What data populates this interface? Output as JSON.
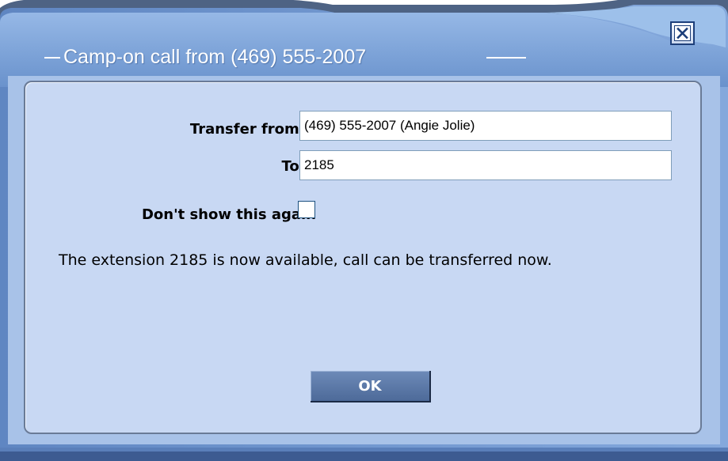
{
  "window": {
    "title": "Camp-on call from (469) 555-2007"
  },
  "form": {
    "transfer_from_label": "Transfer from:",
    "transfer_from_value": "(469) 555-2007 (Angie Jolie)",
    "to_label": "To:",
    "to_value": "2185",
    "dont_show_label": "Don't show this again",
    "dont_show_checked": false
  },
  "message": "The extension 2185 is now available, call can be transferred now.",
  "buttons": {
    "ok_label": "OK"
  },
  "colors": {
    "title_bar": "#7ea3d8",
    "panel": "#c8d8f3",
    "button": "#5d7aaa"
  },
  "icons": {
    "close": "close-icon"
  }
}
